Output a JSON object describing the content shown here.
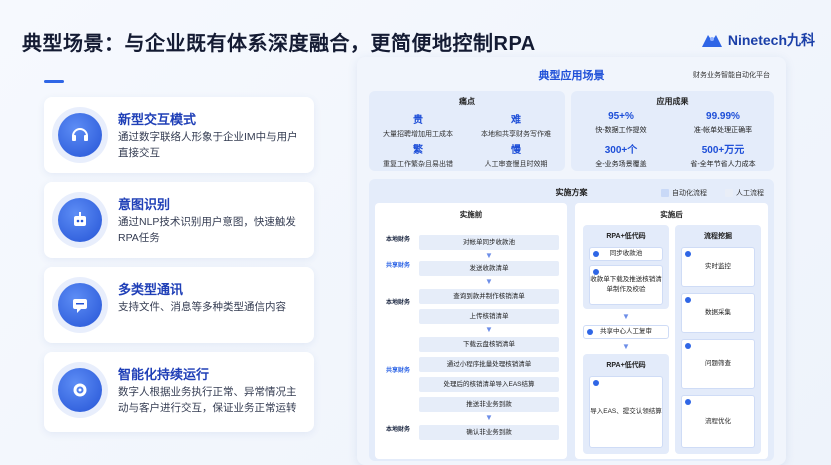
{
  "header": {
    "title": "典型场景：与企业既有体系深度融合，更简便地控制RPA",
    "logo_text": "Ninetech九科"
  },
  "features": [
    {
      "title": "新型交互模式",
      "desc": "通过数字联络人形象于企业IM中与用户直接交互",
      "icon": "headset-icon"
    },
    {
      "title": "意图识别",
      "desc": "通过NLP技术识别用户意图，快速触发RPA任务",
      "icon": "robot-icon"
    },
    {
      "title": "多类型通讯",
      "desc": "支持文件、消息等多种类型通信内容",
      "icon": "chat-icon"
    },
    {
      "title": "智能化持续运行",
      "desc": "数字人根据业务执行正常、异常情况主动与客户进行交互，保证业务正常运转",
      "icon": "gear-icon"
    }
  ],
  "panel": {
    "title": "典型应用场景",
    "subtitle": "财务业务智能自动化平台",
    "pain_points": {
      "head": "痛点",
      "items": [
        {
          "k": "贵",
          "v": "大量招聘增加用工成本"
        },
        {
          "k": "难",
          "v": "本地和共享财务写作难"
        },
        {
          "k": "繁",
          "v": "重复工作繁杂且易出错"
        },
        {
          "k": "慢",
          "v": "人工审查慢且时效期"
        }
      ]
    },
    "results": {
      "head": "应用成果",
      "items": [
        {
          "k": "95+%",
          "v": "快-数据工作提效"
        },
        {
          "k": "99.99%",
          "v": "准-帐单处理正确率"
        },
        {
          "k": "300+个",
          "v": "全-业务场景覆盖"
        },
        {
          "k": "500+万元",
          "v": "省-全年节省人力成本"
        }
      ]
    },
    "solution": {
      "head": "实施方案",
      "legend_auto": "自动化流程",
      "legend_manual": "人工流程",
      "before": {
        "head": "实施前",
        "roles": [
          "本地财务",
          "共享财务",
          "本地财务",
          "共享财务",
          "本地财务"
        ],
        "steps": [
          "对帐单同步收款池",
          "发送收款清单",
          "查询到款并制作核销清单",
          "上传核销清单",
          "下载云盘核销清单",
          "通过小程序批量处理核销清单",
          "处理后的核销清单导入EAS结算",
          "推送非业务到款",
          "确认非业务到款"
        ]
      },
      "after": {
        "head": "实施后",
        "rpa_head_1": "RPA+低代码",
        "flow_head": "流程挖掘",
        "rpa_cards_1": [
          "同步收款池",
          "收款单下载及推送核销清单制作及校验"
        ],
        "flow_cards": [
          "实时监控",
          "数据采集",
          "问题筛查",
          "流程优化"
        ],
        "manual_card": "共享中心人工复审",
        "rpa_head_2": "RPA+低代码",
        "rpa_cards_2": [
          "导入EAS、提交认领结算"
        ]
      }
    }
  },
  "colors": {
    "accent": "#2f66e6",
    "title_blue": "#1e4fd8"
  }
}
